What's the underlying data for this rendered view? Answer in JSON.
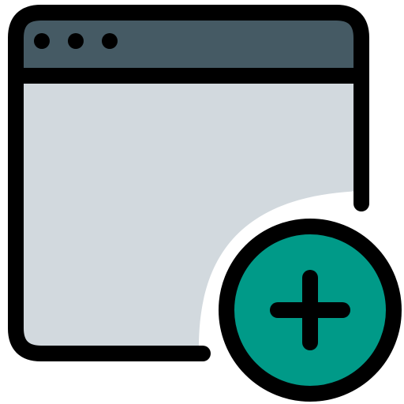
{
  "icon": {
    "semantic": "new-window-icon",
    "parts": {
      "window": "browser-window-icon",
      "title_bar_dots": "window-control-dots-icon",
      "add_badge": "add-circle-icon",
      "plus": "plus-icon"
    }
  },
  "colors": {
    "outline": "#000000",
    "title_bar": "#455A64",
    "window_body": "#D2D9DE",
    "badge_fill": "#009A88",
    "background": "#FFFFFF"
  }
}
